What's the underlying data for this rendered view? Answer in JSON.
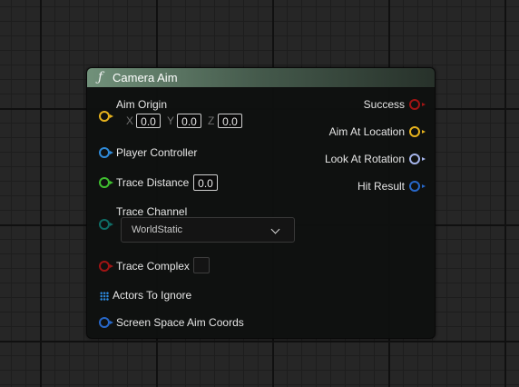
{
  "node": {
    "title": "Camera Aim",
    "icon": "function-icon",
    "inputs": {
      "aim_origin": {
        "label": "Aim Origin",
        "x_label": "X",
        "y_label": "Y",
        "z_label": "Z",
        "x": "0.0",
        "y": "0.0",
        "z": "0.0",
        "color": "#e6b21d"
      },
      "player_controller": {
        "label": "Player Controller",
        "color": "#2f8ad8"
      },
      "trace_distance": {
        "label": "Trace Distance",
        "value": "0.0",
        "color": "#3fbf2f"
      },
      "trace_channel": {
        "label": "Trace Channel",
        "value": "WorldStatic",
        "color": "#0f6d66"
      },
      "trace_complex": {
        "label": "Trace Complex",
        "checked": false,
        "color": "#a11414"
      },
      "actors_to_ignore": {
        "label": "Actors To Ignore",
        "color": "#2d8ae0"
      },
      "screen_space_aim_coords": {
        "label": "Screen Space Aim Coords",
        "color": "#2767c8"
      }
    },
    "outputs": {
      "success": {
        "label": "Success",
        "color": "#a11414"
      },
      "aim_at_location": {
        "label": "Aim At Location",
        "color": "#e6b21d"
      },
      "look_at_rotation": {
        "label": "Look At Rotation",
        "color": "#a5b4ea"
      },
      "hit_result": {
        "label": "Hit Result",
        "color": "#2767c8"
      }
    }
  }
}
